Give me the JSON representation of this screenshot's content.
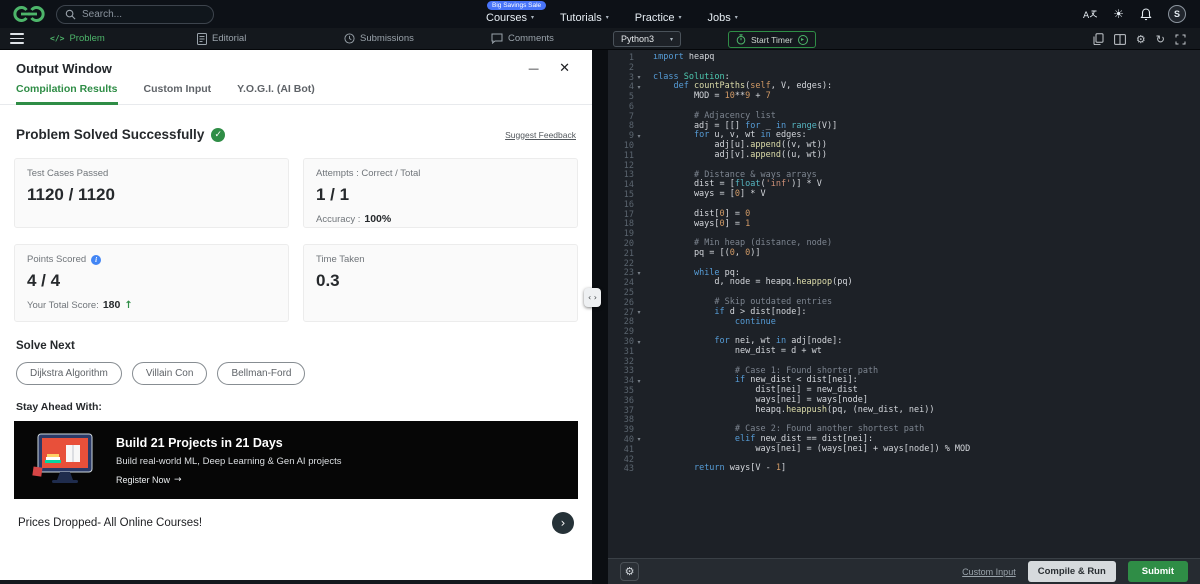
{
  "colors": {
    "brand_green": "#2f8d46",
    "brand_green_light": "#4db56a",
    "sale_blue": "#4874f8"
  },
  "icons": {
    "minimize": "—",
    "close": "✕",
    "gear": "⚙",
    "refresh": "↻",
    "sun": "☀",
    "check": "✓",
    "info": "i",
    "play": "▸",
    "chevron": "▾",
    "code": "</>",
    "up_arrow": "↑",
    "arrow_right": "→",
    "angle_right": "›",
    "drag": "‹ ›"
  },
  "navbar": {
    "search": {
      "placeholder": "Search..."
    },
    "sale_badge": "Big Savings Sale",
    "menu": [
      {
        "label": "Courses"
      },
      {
        "label": "Tutorials"
      },
      {
        "label": "Practice"
      },
      {
        "label": "Jobs"
      }
    ],
    "avatar_initial": "S"
  },
  "toolbar": {
    "tabs": [
      {
        "label": "Problem"
      },
      {
        "label": "Editorial"
      },
      {
        "label": "Submissions"
      },
      {
        "label": "Comments"
      }
    ],
    "language": "Python3",
    "start_timer": "Start Timer"
  },
  "output_window": {
    "title": "Output Window",
    "tabs": [
      {
        "label": "Compilation Results"
      },
      {
        "label": "Custom Input"
      },
      {
        "label": "Y.O.G.I. (AI Bot)"
      }
    ],
    "status": "Problem Solved Successfully",
    "suggest_feedback": "Suggest Feedback",
    "test_cases": {
      "label": "Test Cases Passed",
      "value": "1120 / 1120"
    },
    "attempts": {
      "label": "Attempts : Correct / Total",
      "value": "1 / 1",
      "accuracy_label": "Accuracy :",
      "accuracy_value": "100%"
    },
    "points": {
      "label": "Points Scored",
      "value": "4 / 4",
      "total_label": "Your Total Score:",
      "total_value": "180"
    },
    "time": {
      "label": "Time Taken",
      "value": "0.3"
    },
    "solve_next": {
      "heading": "Solve Next",
      "chips": [
        "Dijkstra Algorithm",
        "Villain Con",
        "Bellman-Ford"
      ]
    },
    "promo": {
      "heading": "Stay Ahead With:",
      "title": "Build 21 Projects in 21 Days",
      "subtitle": "Build real-world ML, Deep Learning & Gen AI projects",
      "cta": "Register Now"
    },
    "courses_banner": "Prices Dropped- All Online Courses!"
  },
  "editor": {
    "language": "python",
    "code_lines": [
      "import heapq",
      "",
      "class Solution:",
      "    def countPaths(self, V, edges):",
      "        MOD = 10**9 + 7",
      "",
      "        # Adjacency list",
      "        adj = [[] for _ in range(V)]",
      "        for u, v, wt in edges:",
      "            adj[u].append((v, wt))",
      "            adj[v].append((u, wt))",
      "",
      "        # Distance & ways arrays",
      "        dist = [float('inf')] * V",
      "        ways = [0] * V",
      "",
      "        dist[0] = 0",
      "        ways[0] = 1",
      "",
      "        # Min heap (distance, node)",
      "        pq = [(0, 0)]",
      "",
      "        while pq:",
      "            d, node = heapq.heappop(pq)",
      "",
      "            # Skip outdated entries",
      "            if d > dist[node]:",
      "                continue",
      "",
      "            for nei, wt in adj[node]:",
      "                new_dist = d + wt",
      "",
      "                # Case 1: Found shorter path",
      "                if new_dist < dist[nei]:",
      "                    dist[nei] = new_dist",
      "                    ways[nei] = ways[node]",
      "                    heapq.heappush(pq, (new_dist, nei))",
      "",
      "                # Case 2: Found another shortest path",
      "                elif new_dist == dist[nei]:",
      "                    ways[nei] = (ways[nei] + ways[node]) % MOD",
      "",
      "        return ways[V - 1]"
    ],
    "footer": {
      "custom_input": "Custom Input",
      "compile_run": "Compile & Run",
      "submit": "Submit"
    }
  }
}
